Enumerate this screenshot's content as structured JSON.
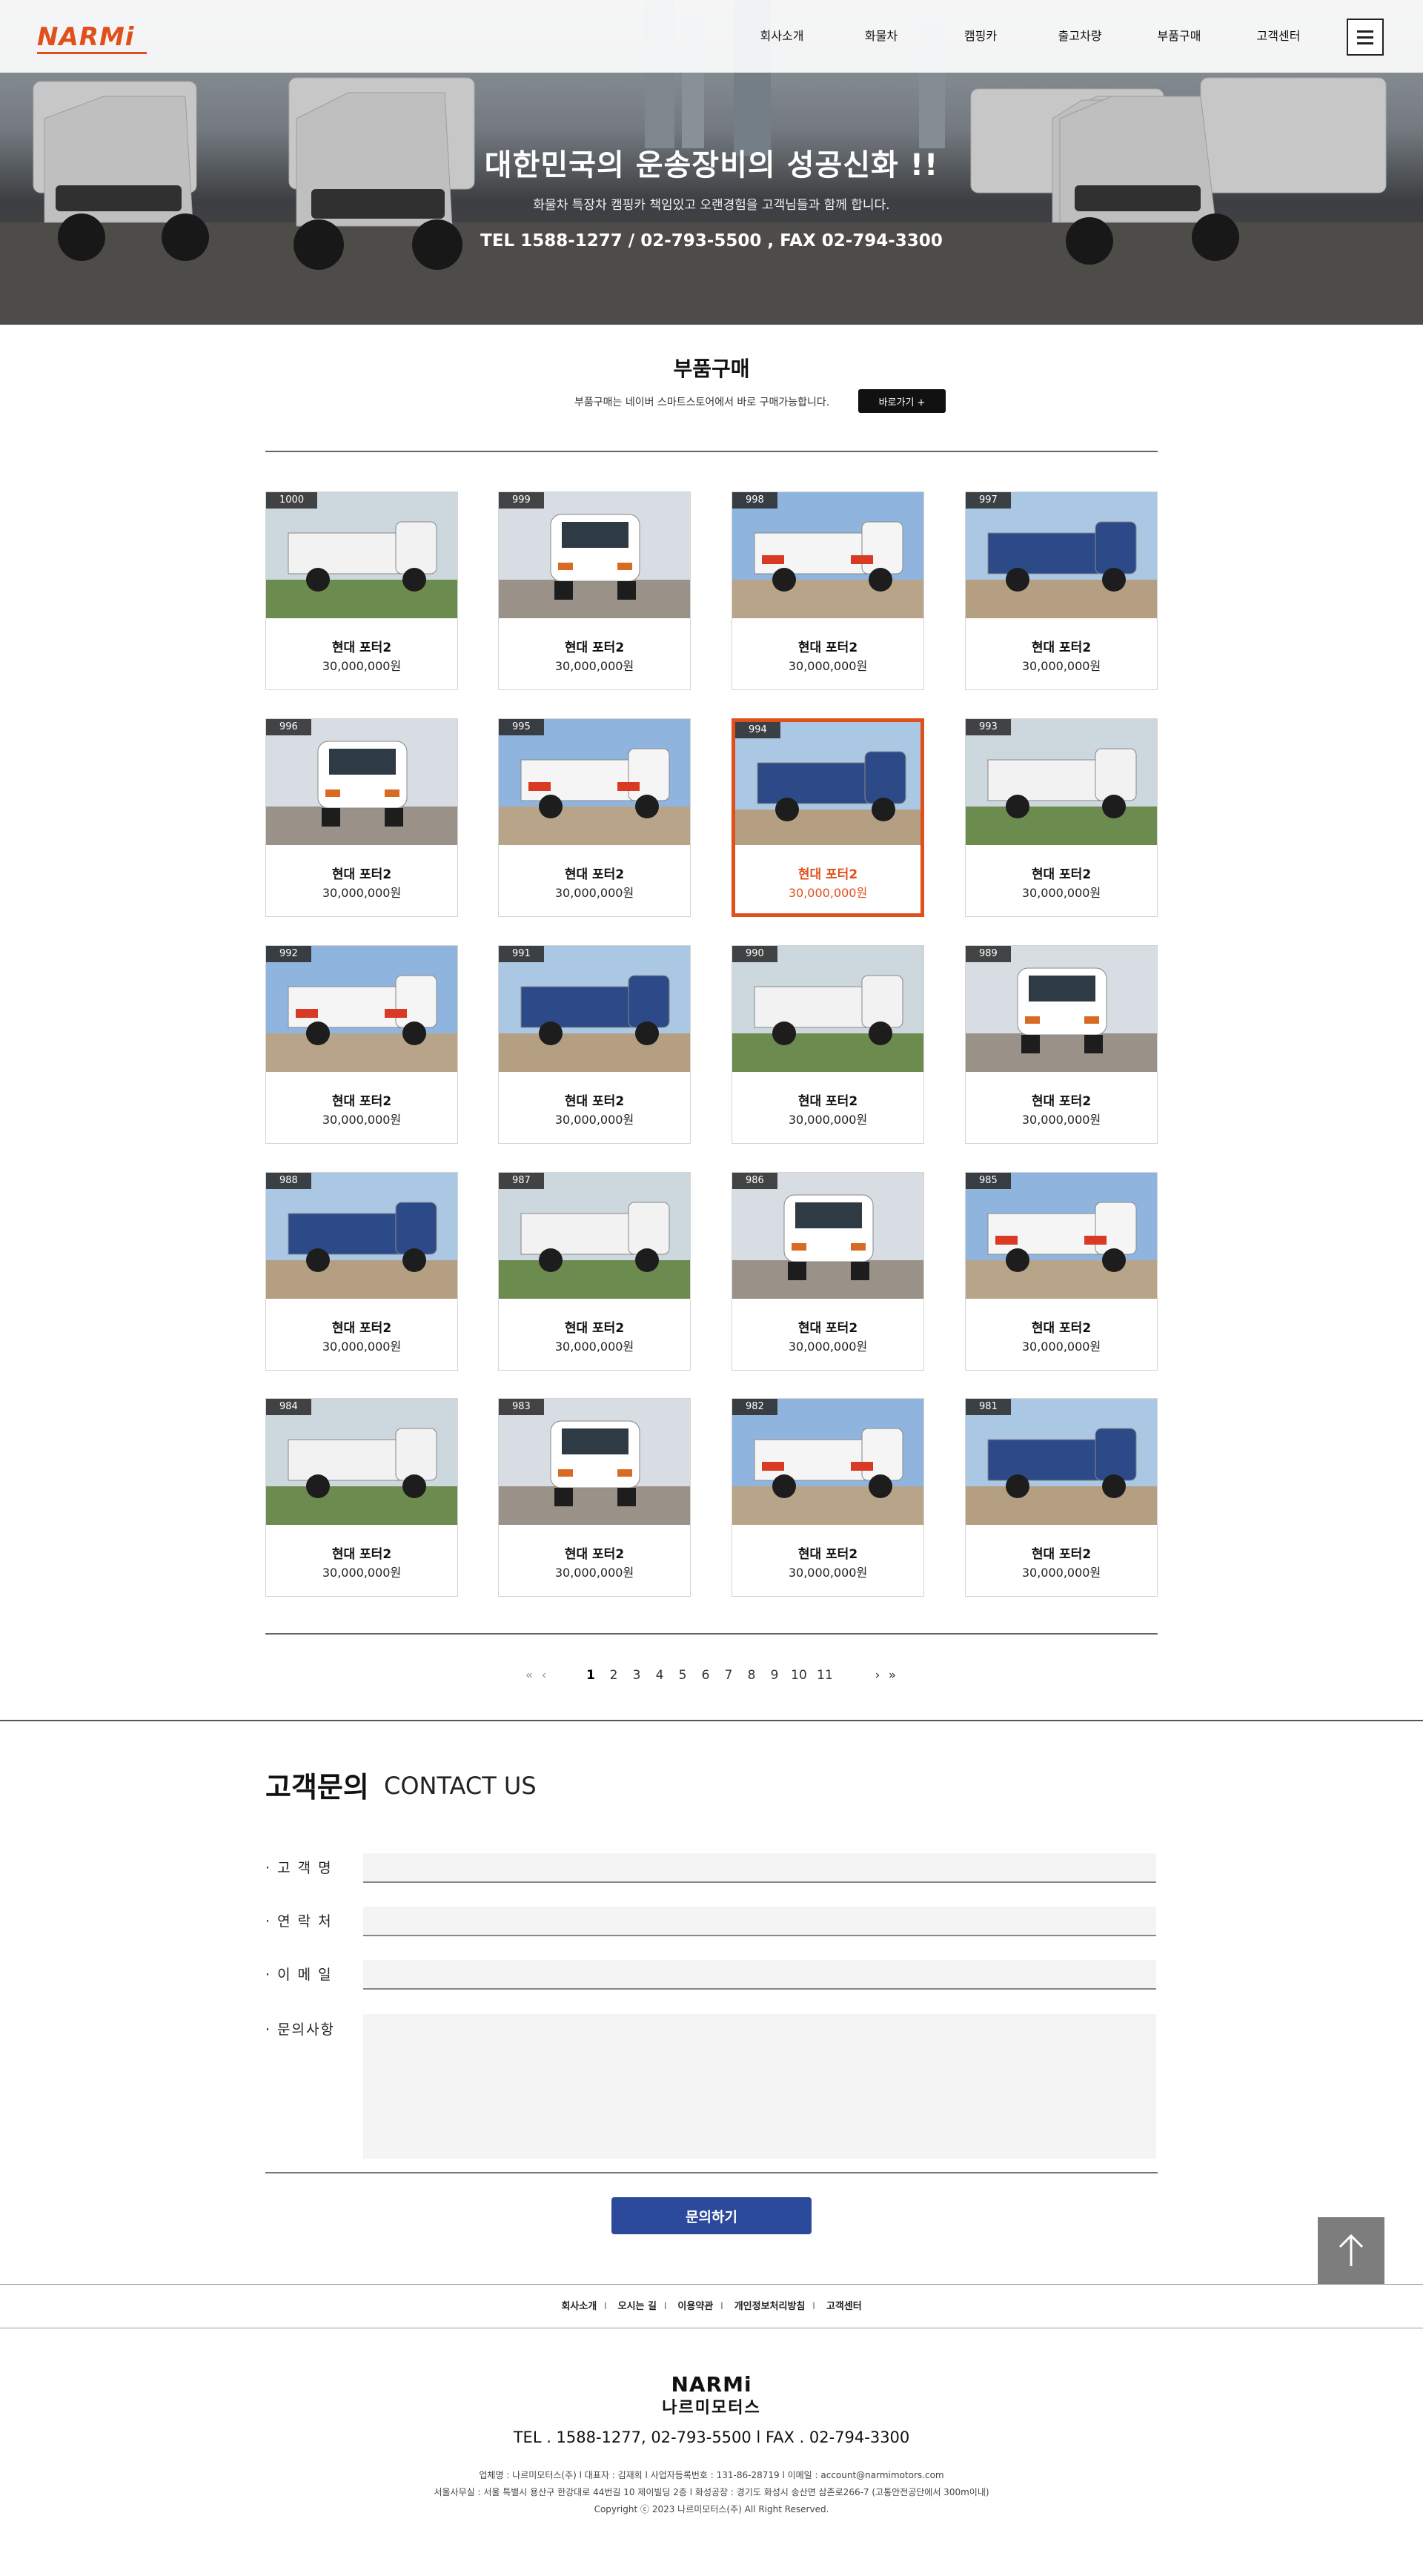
{
  "header": {
    "logo": "NARMi",
    "nav": [
      "회사소개",
      "화물차",
      "캠핑카",
      "출고차량",
      "부품구매",
      "고객센터"
    ]
  },
  "hero": {
    "title": "대한민국의 운송장비의 성공신화 !!",
    "subtitle": "화물차 특장차 캠핑카 책임있고 오랜경험을 고객님들과 함께 합니다.",
    "tel": "TEL  1588-1277 / 02-793-5500 , FAX  02-794-3300"
  },
  "parts": {
    "title": "부품구매",
    "description": "부품구매는 네이버 스마트스토어에서 바로 구매가능합니다.",
    "button": "바로가기  +",
    "items": [
      {
        "num": "1000",
        "name": "현대 포터2",
        "price": "30,000,000원"
      },
      {
        "num": "999",
        "name": "현대 포터2",
        "price": "30,000,000원"
      },
      {
        "num": "998",
        "name": "현대 포터2",
        "price": "30,000,000원"
      },
      {
        "num": "997",
        "name": "현대 포터2",
        "price": "30,000,000원"
      },
      {
        "num": "996",
        "name": "현대 포터2",
        "price": "30,000,000원"
      },
      {
        "num": "995",
        "name": "현대 포터2",
        "price": "30,000,000원"
      },
      {
        "num": "994",
        "name": "현대 포터2",
        "price": "30,000,000원"
      },
      {
        "num": "993",
        "name": "현대 포터2",
        "price": "30,000,000원"
      },
      {
        "num": "992",
        "name": "현대 포터2",
        "price": "30,000,000원"
      },
      {
        "num": "991",
        "name": "현대 포터2",
        "price": "30,000,000원"
      },
      {
        "num": "990",
        "name": "현대 포터2",
        "price": "30,000,000원"
      },
      {
        "num": "989",
        "name": "현대 포터2",
        "price": "30,000,000원"
      },
      {
        "num": "988",
        "name": "현대 포터2",
        "price": "30,000,000원"
      },
      {
        "num": "987",
        "name": "현대 포터2",
        "price": "30,000,000원"
      },
      {
        "num": "986",
        "name": "현대 포터2",
        "price": "30,000,000원"
      },
      {
        "num": "985",
        "name": "현대 포터2",
        "price": "30,000,000원"
      },
      {
        "num": "984",
        "name": "현대 포터2",
        "price": "30,000,000원"
      },
      {
        "num": "983",
        "name": "현대 포터2",
        "price": "30,000,000원"
      },
      {
        "num": "982",
        "name": "현대 포터2",
        "price": "30,000,000원"
      },
      {
        "num": "981",
        "name": "현대 포터2",
        "price": "30,000,000원"
      }
    ]
  },
  "pagination": {
    "pages": [
      "1",
      "2",
      "3",
      "4",
      "5",
      "6",
      "7",
      "8",
      "9",
      "10",
      "11"
    ],
    "current": "1"
  },
  "contact": {
    "title": "고객문의",
    "title_en": "CONTACT US",
    "labels": {
      "name": "· 고 객 명",
      "phone": "· 연 락 처",
      "email": "· 이 메 일",
      "message": "· 문의사항"
    },
    "submit": "문의하기"
  },
  "footer": {
    "links": [
      "회사소개",
      "오시는 길",
      "이용약관",
      "개인정보처리방침",
      "고객센터"
    ],
    "logo": "NARMi",
    "logo_kr": "나르미모터스",
    "tel": "TEL . 1588-1277,  02-793-5500   l   FAX . 02-794-3300",
    "info1": "업체명 : 나르미모터스(주)   l   대표자 : 김재희   l   사업자등록번호 : 131-86-28719   l   이메일 : account@narmimotors.com",
    "info2": "서울사무실 : 서울 특별시 용산구 한강대로 44번길 10 제이빌딩 2층   l   화성공장 : 경기도 화성시 송산면 삼존로266-7 (고통안전공단에서 300m이내)",
    "copyright": "Copyright ⓒ 2023 나르미모터스(주) All Right Reserved."
  },
  "colors": {
    "accent": "#e0501c",
    "submit": "#2b4a9b",
    "dark": "#111111"
  }
}
